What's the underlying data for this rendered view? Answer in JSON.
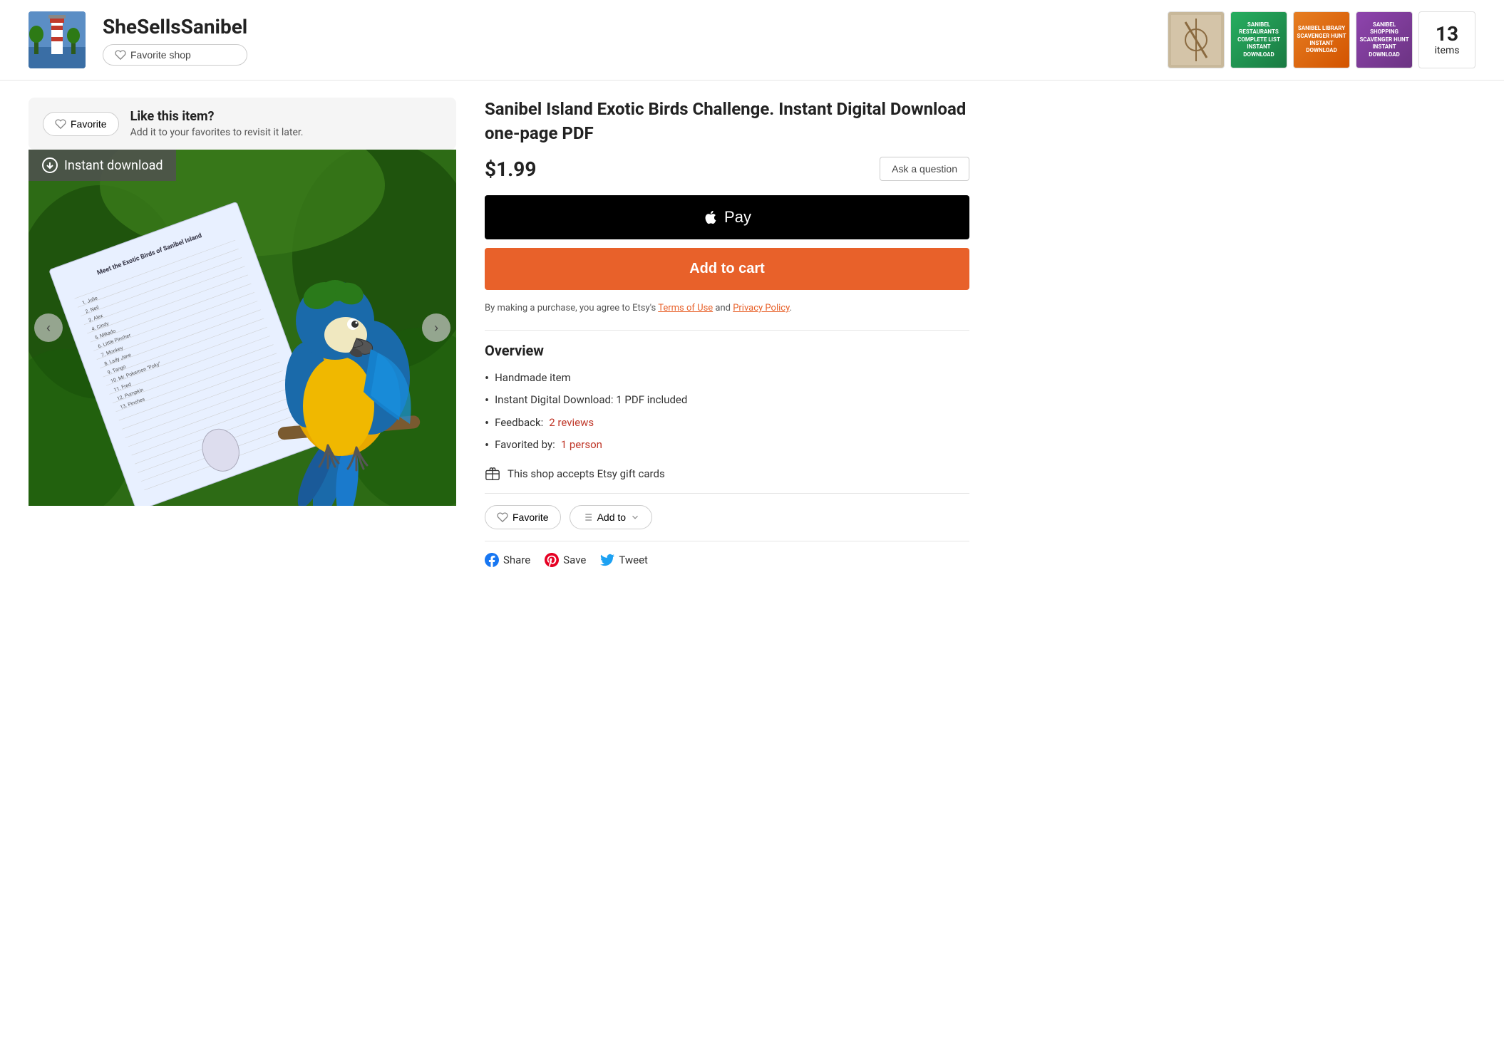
{
  "header": {
    "shop_name": "SheSellsSanibel",
    "favorite_shop_label": "Favorite shop",
    "items_count": "13",
    "items_label": "items",
    "thumbnails": [
      {
        "id": "thumb1",
        "type": "image",
        "alt": "Sanibel bird product"
      },
      {
        "id": "thumb2",
        "type": "green",
        "text": "SANIBEL RESTAURANTS\nCOMPLETE LIST\nINSTANT DOWNLOAD"
      },
      {
        "id": "thumb3",
        "type": "orange",
        "text": "SANIBEL LIBRARY\nSCAVENGER HUNT\nINSTANT DOWNLOAD"
      },
      {
        "id": "thumb4",
        "type": "purple",
        "text": "SANIBEL SHOPPING\nSCAVENGER HUNT\nINSTANT DOWNLOAD"
      }
    ]
  },
  "favorite_bar": {
    "button_label": "Favorite",
    "title": "Like this item?",
    "subtitle": "Add it to your favorites to revisit it later."
  },
  "product": {
    "instant_download_label": "Instant download",
    "nav_left": "‹",
    "nav_right": "›",
    "title": "Sanibel Island Exotic Birds Challenge. Instant Digital Download one-page PDF",
    "price": "$1.99",
    "ask_question_label": "Ask a question",
    "apple_pay_label": "Pay",
    "add_to_cart_label": "Add to cart",
    "terms_text": "By making a purchase, you agree to Etsy's ",
    "terms_link1": "Terms of Use",
    "terms_middle": " and ",
    "terms_link2": "Privacy Policy",
    "terms_end": ".",
    "overview_title": "Overview",
    "overview_items": [
      {
        "text": "Handmade item"
      },
      {
        "text": "Instant Digital Download: 1 PDF included"
      },
      {
        "text": "Feedback: ",
        "link_text": "2 reviews",
        "link_color": "red"
      },
      {
        "text": "Favorited by: ",
        "link_text": "1 person",
        "link_color": "red"
      }
    ],
    "gift_cards_text": "This shop accepts Etsy gift cards",
    "favorite_label": "Favorite",
    "add_to_label": "Add to",
    "share_label": "Share",
    "save_label": "Save",
    "tweet_label": "Tweet"
  },
  "colors": {
    "add_to_cart_bg": "#e8612a",
    "apple_pay_bg": "#000000",
    "link_color": "#e8612a",
    "review_color": "#c0392b",
    "fb_color": "#1877f2",
    "pin_color": "#e60023",
    "tw_color": "#1da1f2"
  }
}
